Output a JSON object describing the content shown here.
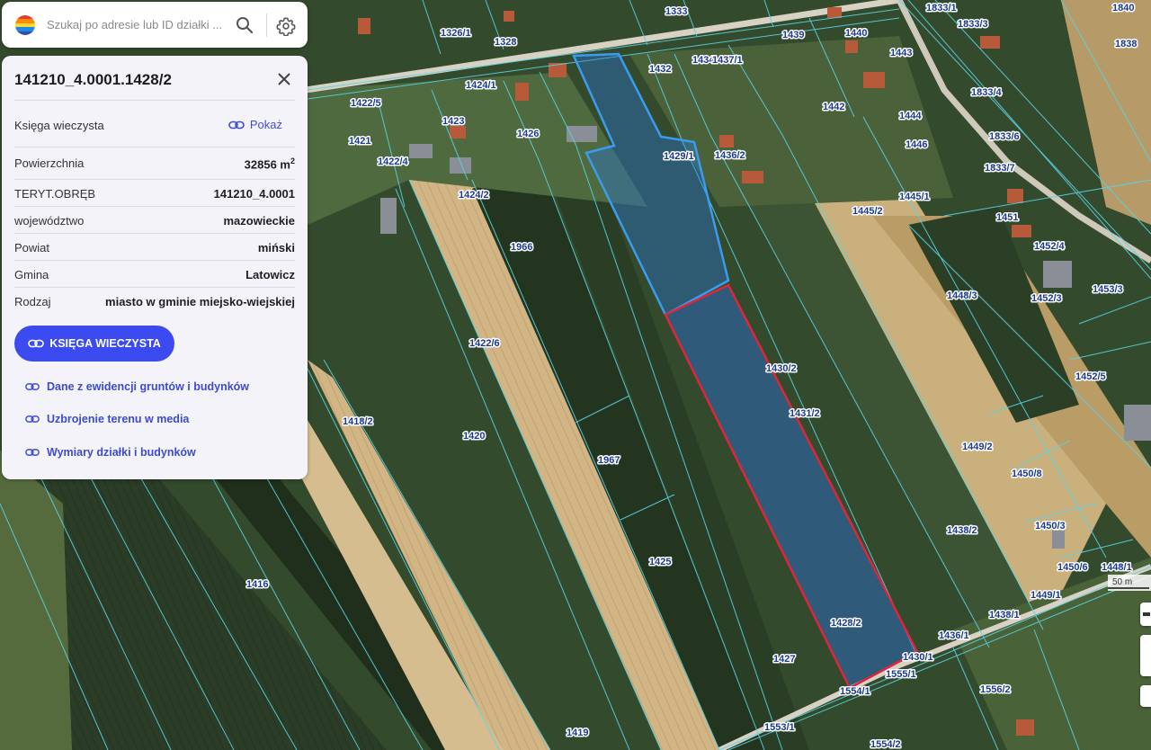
{
  "search": {
    "placeholder": "Szukaj po adresie lub ID działki ...",
    "logo_colors": [
      "#e53935",
      "#fb8c00",
      "#fdd835",
      "#1e88e5",
      "#3949ab"
    ]
  },
  "panel": {
    "title": "141210_4.0001.1428/2",
    "kw_label": "Księga wieczysta",
    "kw_action": "Pokaż",
    "rows": [
      {
        "key": "Powierzchnia",
        "value": "32856 m",
        "sup": "2"
      },
      {
        "key": "TERYT.OBRĘB",
        "value": "141210_4.0001"
      },
      {
        "key": "województwo",
        "value": "mazowieckie"
      },
      {
        "key": "Powiat",
        "value": "miński"
      },
      {
        "key": "Gmina",
        "value": "Latowicz"
      },
      {
        "key": "Rodzaj",
        "value": "miasto w gminie miejsko-wiejskiej"
      }
    ],
    "primary_button": "KSIĘGA WIECZYSTA",
    "links": [
      "Dane z ewidencji gruntów i budynków",
      "Uzbrojenie terenu w media",
      "Wymiary działki i budynków"
    ],
    "accent": "#3c4bef"
  },
  "map": {
    "scale_label": "50 m",
    "selected_parcel": "1428/2",
    "selected_color": "#e0253a",
    "neighbor_highlight_color": "#2f8fe8",
    "parcel_labels": [
      "1326/1",
      "1328",
      "1333",
      "1439",
      "1440",
      "1833/1",
      "1833/3",
      "1838",
      "1432",
      "1434",
      "1437/1",
      "1443",
      "1424/1",
      "1442",
      "1422/5",
      "1423",
      "1426",
      "1444",
      "1833/4",
      "1421",
      "1429/1",
      "1436/2",
      "1446",
      "1833/6",
      "1422/4",
      "1833/7",
      "1424/2",
      "1445/1",
      "1445/2",
      "1451",
      "1966",
      "1452/4",
      "1448/3",
      "1452/3",
      "1453/3",
      "1422/6",
      "1430/2",
      "1452/5",
      "1418/2",
      "1431/2",
      "1420",
      "1449/2",
      "1967",
      "1450/8",
      "1438/2",
      "1450/3",
      "1425",
      "1416",
      "1450/6",
      "1448/1",
      "1449/1",
      "1428/2",
      "1438/1",
      "1436/1",
      "1427",
      "1430/1",
      "1555/1",
      "1556/2",
      "1554/1",
      "1553/1",
      "1419",
      "1554/2",
      "1840"
    ]
  }
}
